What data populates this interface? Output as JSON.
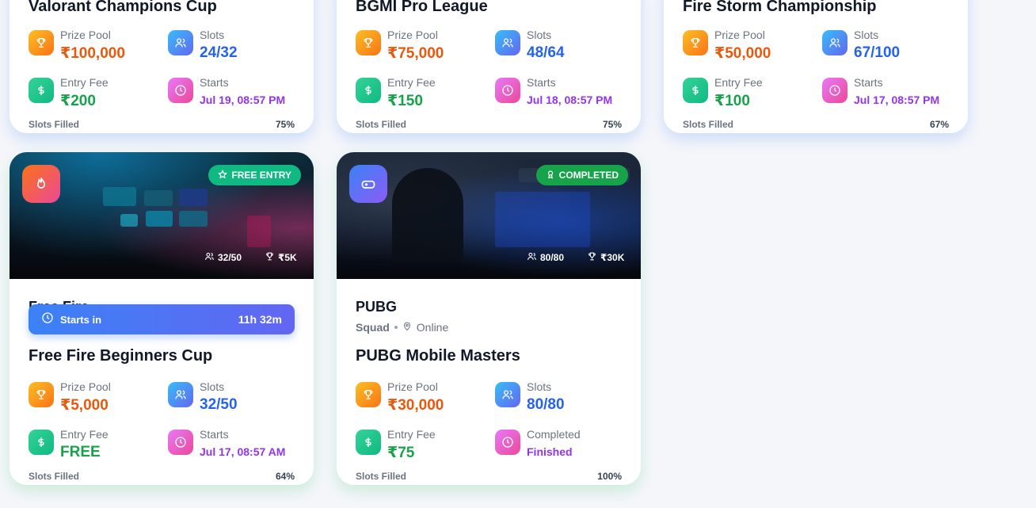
{
  "cards": [
    {
      "title": "Valorant Champions Cup",
      "prize_label": "Prize Pool",
      "prize": "₹100,000",
      "slots_label": "Slots",
      "slots": "24/32",
      "fee_label": "Entry Fee",
      "fee": "₹200",
      "start_label": "Starts",
      "start": "Jul 19, 08:57 PM",
      "filled_label": "Slots Filled",
      "filled_pct": "75%"
    },
    {
      "title": "BGMI Pro League",
      "prize_label": "Prize Pool",
      "prize": "₹75,000",
      "slots_label": "Slots",
      "slots": "48/64",
      "fee_label": "Entry Fee",
      "fee": "₹150",
      "start_label": "Starts",
      "start": "Jul 18, 08:57 PM",
      "filled_label": "Slots Filled",
      "filled_pct": "75%"
    },
    {
      "title": "Fire Storm Championship",
      "prize_label": "Prize Pool",
      "prize": "₹50,000",
      "slots_label": "Slots",
      "slots": "67/100",
      "fee_label": "Entry Fee",
      "fee": "₹100",
      "start_label": "Starts",
      "start": "Jul 17, 08:57 PM",
      "filled_label": "Slots Filled",
      "filled_pct": "67%"
    },
    {
      "badge": "FREE ENTRY",
      "hero_slots": "32/50",
      "hero_prize": "₹5K",
      "game": "Free Fire",
      "countdown_label": "Starts in",
      "countdown": "11h 32m",
      "title": "Free Fire Beginners Cup",
      "prize_label": "Prize Pool",
      "prize": "₹5,000",
      "slots_label": "Slots",
      "slots": "32/50",
      "fee_label": "Entry Fee",
      "fee": "FREE",
      "start_label": "Starts",
      "start": "Jul 17, 08:57 AM",
      "filled_label": "Slots Filled",
      "filled_pct": "64%"
    },
    {
      "badge": "COMPLETED",
      "hero_slots": "80/80",
      "hero_prize": "₹30K",
      "game": "PUBG",
      "mode": "Squad",
      "location": "Online",
      "title": "PUBG Mobile Masters",
      "prize_label": "Prize Pool",
      "prize": "₹30,000",
      "slots_label": "Slots",
      "slots": "80/80",
      "fee_label": "Entry Fee",
      "fee": "₹75",
      "start_label": "Completed",
      "start": "Finished",
      "filled_label": "Slots Filled",
      "filled_pct": "100%"
    }
  ],
  "icons": {
    "prize": "trophy-icon",
    "slots": "users-icon",
    "fee": "dollar-icon",
    "start": "clock-icon",
    "free_badge": "star-icon",
    "done_badge": "award-icon",
    "location": "map-pin-icon",
    "game_ff": "flame-icon",
    "game_pubg": "gamepad-icon"
  },
  "colors": {
    "prize": "#ea580c",
    "slots": "#2563eb",
    "fee": "#16a34a",
    "start": "#9333ea",
    "badge_free": "#10b981",
    "badge_done": "#16a34a",
    "countdown": "#4f6ef7"
  }
}
